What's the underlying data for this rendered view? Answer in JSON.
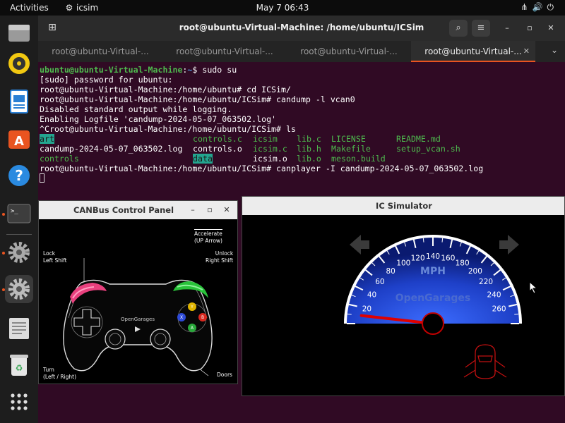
{
  "topbar": {
    "activities": "Activities",
    "app_name": "icsim",
    "clock": "May 7  06:43"
  },
  "dock": {
    "items": [
      "files",
      "rhythmbox",
      "libreoffice-writer",
      "app-center",
      "help",
      "terminal",
      "settings",
      "settings",
      "save",
      "trash",
      "show-apps"
    ]
  },
  "terminal": {
    "title": "root@ubuntu-Virtual-Machine: /home/ubuntu/ICSim",
    "tabs": [
      {
        "label": "root@ubuntu-Virtual-..."
      },
      {
        "label": "root@ubuntu-Virtual-..."
      },
      {
        "label": "root@ubuntu-Virtual-..."
      },
      {
        "label": "root@ubuntu-Virtual-..."
      }
    ],
    "lines": {
      "l1_user": "ubuntu@ubuntu-Virtual-Machine",
      "l1_sep": ":",
      "l1_path": "~",
      "l1_cmd": "$ sudo su",
      "l2": "[sudo] password for ubuntu:",
      "l3": "root@ubuntu-Virtual-Machine:/home/ubuntu# cd ICSim/",
      "l4": "root@ubuntu-Virtual-Machine:/home/ubuntu/ICSim# candump -l vcan0",
      "l5": "Disabled standard output while logging.",
      "l6": "Enabling Logfile 'candump-2024-05-07_063502.log'",
      "l7": "^Croot@ubuntu-Virtual-Machine:/home/ubuntu/ICSim# ls",
      "ls": {
        "r1": [
          "art",
          "controls.c",
          "icsim",
          "lib.c",
          "LICENSE",
          "README.md"
        ],
        "r2": [
          "candump-2024-05-07_063502.log",
          "controls.o",
          "icsim.c",
          "lib.h",
          "Makefile",
          "setup_vcan.sh"
        ],
        "r3": [
          "controls",
          "data",
          "icsim.o",
          "lib.o",
          "meson.build"
        ]
      },
      "l11": "root@ubuntu-Virtual-Machine:/home/ubuntu/ICSim# canplayer -I candump-2024-05-07_063502.log"
    }
  },
  "canbus": {
    "title": "CANBus Control Panel",
    "labels": {
      "accelerate": "Accelerate",
      "up_arrow": "(UP Arrow)",
      "lock": "Lock",
      "left_shift": "Left Shift",
      "unlock": "Unlock",
      "right_shift": "Right Shift",
      "brand": "OpenGarages",
      "turn": "Turn",
      "turn_keys": "(Left / Right)",
      "doors": "Doors"
    },
    "buttons": [
      "Y",
      "X",
      "B",
      "A"
    ]
  },
  "icsim": {
    "title": "IC Simulator",
    "unit": "MPH",
    "brand": "OpenGarages",
    "speed_ticks": [
      "20",
      "40",
      "60",
      "80",
      "100",
      "120",
      "140",
      "160",
      "180",
      "200",
      "220",
      "240",
      "260"
    ],
    "needle_speed": 10
  },
  "colors": {
    "ubuntu_orange": "#e95420",
    "terminal_bg": "#300a24",
    "gauge_blue": "#1e40c8",
    "needle_red": "#e00000"
  }
}
